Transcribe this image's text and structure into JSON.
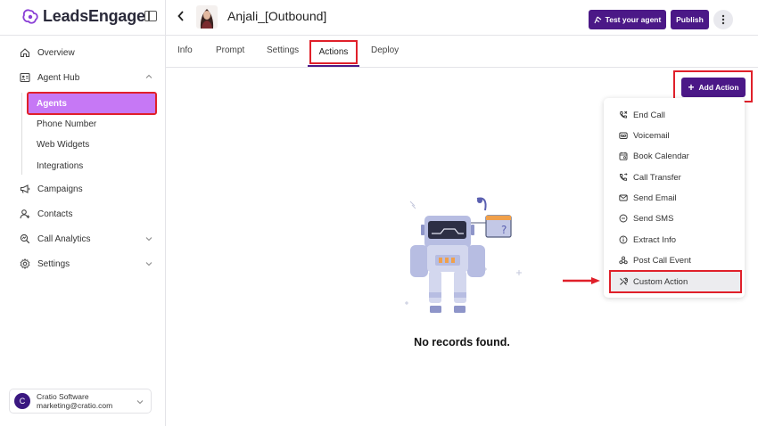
{
  "brand": {
    "name": "LeadsEngage"
  },
  "sidebar": {
    "items": [
      {
        "label": "Overview",
        "icon": "home-icon"
      },
      {
        "label": "Agent Hub",
        "icon": "agent-hub-icon"
      },
      {
        "label": "Campaigns",
        "icon": "megaphone-icon"
      },
      {
        "label": "Contacts",
        "icon": "contacts-icon"
      },
      {
        "label": "Call Analytics",
        "icon": "call-analytics-icon"
      },
      {
        "label": "Settings",
        "icon": "settings-icon"
      }
    ],
    "agent_hub_children": [
      {
        "label": "Agents",
        "active": true
      },
      {
        "label": "Phone Number"
      },
      {
        "label": "Web Widgets"
      },
      {
        "label": "Integrations"
      }
    ]
  },
  "account": {
    "initial": "C",
    "name": "Cratio Software",
    "email": "marketing@cratio.com"
  },
  "header": {
    "agent_name": "Anjali_[Outbound]",
    "test_label": "Test your agent",
    "publish_label": "Publish"
  },
  "tabs": [
    {
      "label": "Info"
    },
    {
      "label": "Prompt"
    },
    {
      "label": "Settings"
    },
    {
      "label": "Actions",
      "active": true
    },
    {
      "label": "Deploy"
    }
  ],
  "actions": {
    "add_label": "Add Action",
    "menu": [
      {
        "label": "End Call",
        "icon": "end-call-icon"
      },
      {
        "label": "Voicemail",
        "icon": "voicemail-icon"
      },
      {
        "label": "Book Calendar",
        "icon": "calendar-icon"
      },
      {
        "label": "Call Transfer",
        "icon": "call-transfer-icon"
      },
      {
        "label": "Send Email",
        "icon": "email-icon"
      },
      {
        "label": "Send SMS",
        "icon": "sms-icon"
      },
      {
        "label": "Extract Info",
        "icon": "info-icon"
      },
      {
        "label": "Post Call Event",
        "icon": "webhook-icon"
      },
      {
        "label": "Custom Action",
        "icon": "tools-icon",
        "highlighted": true
      }
    ]
  },
  "empty_state": {
    "message": "No records found."
  },
  "colors": {
    "primary": "#4b1887",
    "active_nav": "#c678f5",
    "highlight_outline": "#e0202a"
  }
}
